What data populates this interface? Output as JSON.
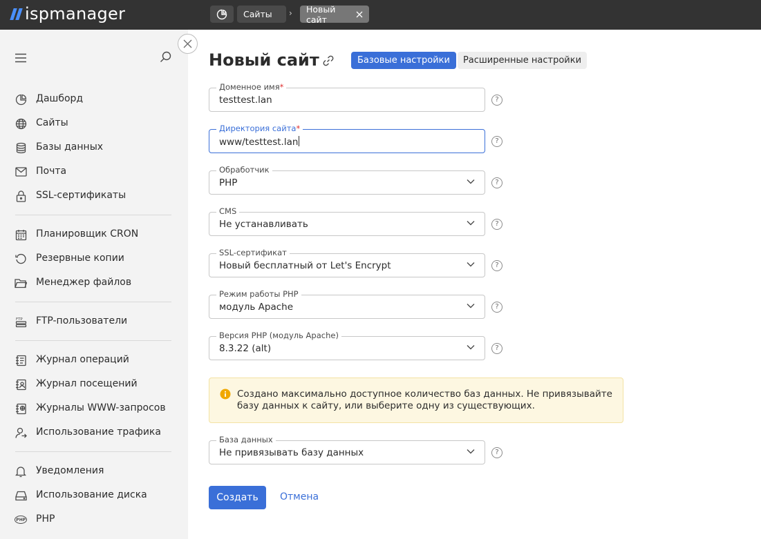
{
  "app": {
    "logo": "ispmanager"
  },
  "breadcrumb": {
    "sites": "Сайты",
    "new_site": "Новый сайт"
  },
  "sidebar": {
    "items": [
      {
        "id": "dashboard",
        "label": "Дашборд",
        "icon": "dashboard-icon"
      },
      {
        "id": "sites",
        "label": "Сайты",
        "icon": "globe-icon"
      },
      {
        "id": "databases",
        "label": "Базы данных",
        "icon": "database-icon"
      },
      {
        "id": "mail",
        "label": "Почта",
        "icon": "mail-icon"
      },
      {
        "id": "ssl",
        "label": "SSL-сертификаты",
        "icon": "lock-icon"
      },
      {
        "id": "cron",
        "label": "Планировщик CRON",
        "icon": "calendar-icon"
      },
      {
        "id": "backups",
        "label": "Резервные копии",
        "icon": "restore-icon"
      },
      {
        "id": "files",
        "label": "Менеджер файлов",
        "icon": "folder-icon"
      },
      {
        "id": "ftp",
        "label": "FTP-пользователи",
        "icon": "ftp-icon"
      },
      {
        "id": "oplog",
        "label": "Журнал операций",
        "icon": "journal-icon"
      },
      {
        "id": "visitlog",
        "label": "Журнал посещений",
        "icon": "visits-icon"
      },
      {
        "id": "wwwlogs",
        "label": "Журналы WWW-запросов",
        "icon": "web-log-icon"
      },
      {
        "id": "traffic",
        "label": "Использование трафика",
        "icon": "user-traffic-icon"
      },
      {
        "id": "notifications",
        "label": "Уведомления",
        "icon": "bell-icon"
      },
      {
        "id": "disk",
        "label": "Использование диска",
        "icon": "disk-icon"
      },
      {
        "id": "php",
        "label": "PHP",
        "icon": "php-icon"
      }
    ]
  },
  "page": {
    "title": "Новый сайт"
  },
  "tabs": {
    "basic": "Базовые настройки",
    "advanced": "Расширенные настройки"
  },
  "form": {
    "domain": {
      "label": "Доменное имя",
      "value": "testtest.lan"
    },
    "directory": {
      "label": "Директория сайта",
      "value": "www/testtest.lan"
    },
    "handler": {
      "label": "Обработчик",
      "value": "PHP"
    },
    "cms": {
      "label": "CMS",
      "value": "Не устанавливать"
    },
    "ssl": {
      "label": "SSL-сертификат",
      "value": "Новый бесплатный от Let's Encrypt"
    },
    "php_mode": {
      "label": "Режим работы PHP",
      "value": "модуль Apache"
    },
    "php_version": {
      "label": "Версия PHP (модуль Apache)",
      "value": "8.3.22 (alt)"
    },
    "database": {
      "label": "База данных",
      "value": "Не привязывать базу данных"
    },
    "required_mark": "*",
    "help_mark": "?"
  },
  "notice": {
    "text": "Создано максимально доступное количество баз данных. Не привязывайте базу данных к сайту, или выберите одну из существующих."
  },
  "actions": {
    "create": "Создать",
    "cancel": "Отмена"
  },
  "colors": {
    "accent": "#3a6fd8",
    "topbar": "#333333",
    "sidebar": "#f3f3f3",
    "notice_bg": "#fdf7e1",
    "required": "#e03131",
    "logo_mark": "#4a90ff"
  }
}
